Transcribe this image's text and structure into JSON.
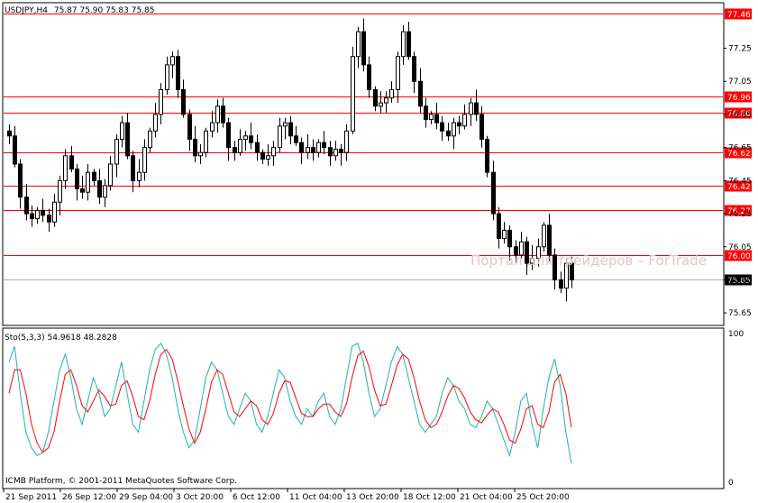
{
  "header": {
    "symbol": "USDJPY,H4",
    "ohlc": "75.87 75.90 75.83 75.85"
  },
  "indicator": {
    "label": "Sto(5,3,3) 54.9618 48.2828",
    "scale_top": "100",
    "scale_bottom": "0",
    "main_color": "#20b2aa",
    "signal_color": "#ff0000"
  },
  "footer": {
    "copyright": "ICMB Platform, © 2001-2011 MetaQuotes Software Corp."
  },
  "watermark": "Портал для трейдеров – ForTrade",
  "chart_data": {
    "type": "candlestick",
    "symbol": "USDJPY",
    "timeframe": "H4",
    "price_range": [
      75.58,
      77.52
    ],
    "price_ticks": [
      "77.25",
      "77.05",
      "76.85",
      "76.65",
      "76.45",
      "76.25",
      "76.05",
      "75.85",
      "75.65"
    ],
    "current_price": "75.85",
    "horizontal_levels": [
      "77.46",
      "76.96",
      "76.86",
      "76.62",
      "76.42",
      "76.27",
      "76.00"
    ],
    "level_color": "#ff0000",
    "x_labels": [
      "21 Sep 2011",
      "26 Sep 12:00",
      "29 Sep 04:00",
      "3 Oct 20:00",
      "6 Oct 12:00",
      "11 Oct 04:00",
      "13 Oct 20:00",
      "18 Oct 12:00",
      "21 Oct 04:00",
      "25 Oct 20:00"
    ],
    "closes": [
      76.72,
      76.55,
      76.35,
      76.25,
      76.22,
      76.27,
      76.24,
      76.2,
      76.32,
      76.45,
      76.6,
      76.52,
      76.4,
      76.38,
      76.5,
      76.45,
      76.35,
      76.42,
      76.55,
      76.7,
      76.8,
      76.6,
      76.45,
      76.5,
      76.65,
      76.75,
      76.85,
      77.0,
      77.15,
      77.2,
      77.0,
      76.85,
      76.7,
      76.6,
      76.62,
      76.75,
      76.8,
      76.9,
      76.8,
      76.65,
      76.62,
      76.7,
      76.72,
      76.68,
      76.62,
      76.58,
      76.6,
      76.65,
      76.78,
      76.8,
      76.72,
      76.68,
      76.62,
      76.65,
      76.62,
      76.68,
      76.65,
      76.6,
      76.64,
      76.62,
      76.75,
      77.2,
      77.35,
      77.15,
      77.0,
      76.9,
      76.92,
      76.95,
      77.0,
      77.2,
      77.35,
      77.2,
      77.05,
      76.9,
      76.82,
      76.85,
      76.8,
      76.75,
      76.72,
      76.8,
      76.78,
      76.85,
      76.92,
      76.85,
      76.7,
      76.5,
      76.25,
      76.1,
      76.15,
      76.05,
      76.0,
      76.08,
      75.95,
      75.98,
      76.05,
      76.18,
      76.0,
      75.85,
      75.8,
      75.95,
      75.85
    ],
    "stochastic": {
      "main": [
        80,
        90,
        60,
        35,
        25,
        20,
        22,
        35,
        55,
        75,
        85,
        70,
        50,
        40,
        55,
        70,
        60,
        45,
        50,
        65,
        80,
        60,
        40,
        35,
        55,
        75,
        88,
        92,
        85,
        70,
        50,
        35,
        25,
        30,
        50,
        70,
        80,
        75,
        60,
        45,
        40,
        50,
        60,
        55,
        40,
        35,
        45,
        60,
        75,
        70,
        55,
        45,
        40,
        50,
        45,
        55,
        60,
        45,
        40,
        50,
        70,
        90,
        92,
        80,
        60,
        45,
        50,
        65,
        80,
        90,
        85,
        70,
        55,
        40,
        35,
        40,
        45,
        60,
        70,
        65,
        55,
        50,
        40,
        38,
        45,
        55,
        50,
        40,
        30,
        20,
        35,
        55,
        60,
        40,
        25,
        50,
        70,
        82,
        65,
        35,
        15
      ],
      "signal": [
        60,
        75,
        75,
        60,
        40,
        28,
        22,
        25,
        35,
        55,
        72,
        75,
        65,
        52,
        48,
        55,
        62,
        58,
        52,
        53,
        65,
        68,
        58,
        45,
        43,
        55,
        72,
        85,
        88,
        82,
        68,
        52,
        37,
        28,
        35,
        50,
        67,
        75,
        72,
        60,
        48,
        45,
        50,
        55,
        52,
        43,
        40,
        47,
        60,
        68,
        67,
        57,
        47,
        45,
        45,
        50,
        53,
        53,
        48,
        45,
        53,
        70,
        84,
        87,
        77,
        62,
        52,
        53,
        65,
        78,
        85,
        82,
        70,
        55,
        43,
        38,
        40,
        48,
        58,
        65,
        63,
        57,
        48,
        43,
        41,
        46,
        50,
        48,
        40,
        30,
        28,
        37,
        50,
        52,
        40,
        38,
        48,
        67,
        72,
        60,
        38
      ]
    }
  }
}
